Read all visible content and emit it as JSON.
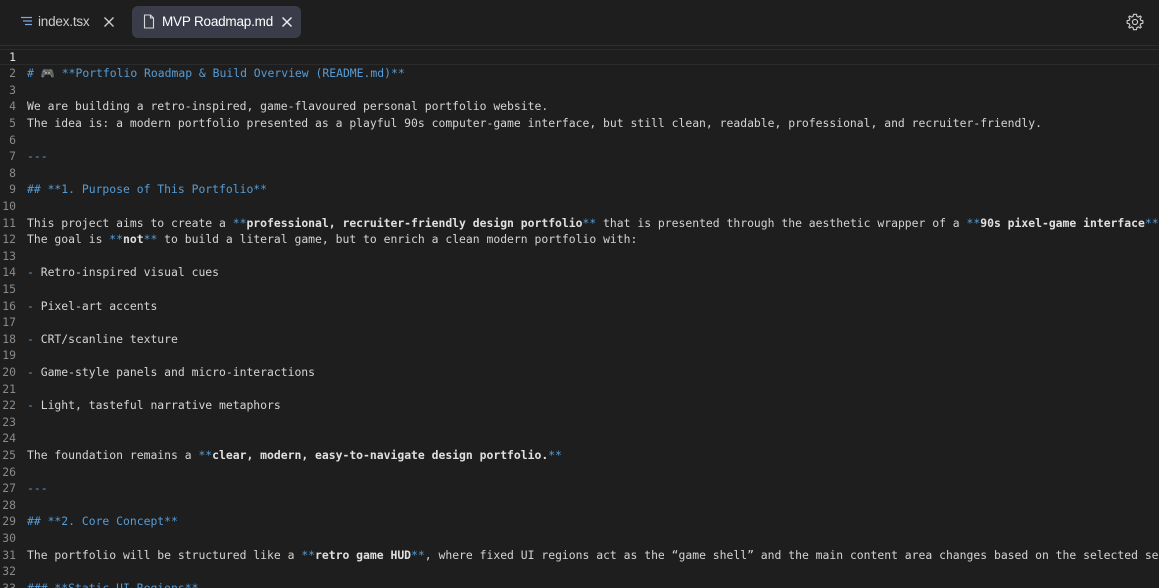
{
  "tabs": [
    {
      "label": "index.tsx",
      "icon": "list-lines-icon",
      "active": false
    },
    {
      "label": "MVP Roadmap.md",
      "icon": "file-icon",
      "active": true
    }
  ],
  "toolbar": {
    "settings_icon": "gear-icon"
  },
  "editor": {
    "current_line": 1,
    "lines": [
      {
        "n": "1",
        "segs": []
      },
      {
        "n": "2",
        "segs": [
          {
            "t": "# ",
            "c": "md-h"
          },
          {
            "t": "🎮",
            "c": "md-h"
          },
          {
            "t": " **Portfolio Roadmap & Build Overview ",
            "c": "md-h"
          },
          {
            "t": "(",
            "c": "md-mark"
          },
          {
            "t": "README.md",
            "c": "md-h"
          },
          {
            "t": ")",
            "c": "md-mark"
          },
          {
            "t": "**",
            "c": "md-h"
          }
        ]
      },
      {
        "n": "3",
        "segs": []
      },
      {
        "n": "4",
        "segs": [
          {
            "t": "We are building a retro-inspired, game-flavoured personal portfolio website."
          }
        ]
      },
      {
        "n": "5",
        "segs": [
          {
            "t": "The idea is: a modern portfolio presented as a playful 90s computer-game interface, but still clean, readable, professional, and recruiter-friendly."
          }
        ]
      },
      {
        "n": "6",
        "segs": []
      },
      {
        "n": "7",
        "segs": [
          {
            "t": "---",
            "c": "md-hr"
          }
        ]
      },
      {
        "n": "8",
        "segs": []
      },
      {
        "n": "9",
        "segs": [
          {
            "t": "## **1. Purpose of This Portfolio**",
            "c": "md-h"
          }
        ]
      },
      {
        "n": "10",
        "segs": []
      },
      {
        "n": "11",
        "segs": [
          {
            "t": "This project aims to create a "
          },
          {
            "t": "**",
            "c": "md-mark"
          },
          {
            "t": "professional, recruiter-friendly design portfolio",
            "c": "md-b"
          },
          {
            "t": "**",
            "c": "md-mark"
          },
          {
            "t": " that is presented through the aesthetic wrapper of a "
          },
          {
            "t": "**",
            "c": "md-mark"
          },
          {
            "t": "90s pixel-game interface",
            "c": "md-b"
          },
          {
            "t": "**",
            "c": "md-mark"
          },
          {
            "t": "."
          }
        ]
      },
      {
        "n": "12",
        "segs": [
          {
            "t": "The goal is "
          },
          {
            "t": "**",
            "c": "md-mark"
          },
          {
            "t": "not",
            "c": "md-b"
          },
          {
            "t": "**",
            "c": "md-mark"
          },
          {
            "t": " to build a literal game, but to enrich a clean modern portfolio with:"
          }
        ]
      },
      {
        "n": "13",
        "segs": []
      },
      {
        "n": "14",
        "segs": [
          {
            "t": "-",
            "c": "md-bullet"
          },
          {
            "t": " Retro-inspired visual cues"
          }
        ]
      },
      {
        "n": "15",
        "segs": []
      },
      {
        "n": "16",
        "segs": [
          {
            "t": "-",
            "c": "md-bullet"
          },
          {
            "t": " Pixel-art accents"
          }
        ]
      },
      {
        "n": "17",
        "segs": []
      },
      {
        "n": "18",
        "segs": [
          {
            "t": "-",
            "c": "md-bullet"
          },
          {
            "t": " CRT/scanline texture"
          }
        ]
      },
      {
        "n": "19",
        "segs": []
      },
      {
        "n": "20",
        "segs": [
          {
            "t": "-",
            "c": "md-bullet"
          },
          {
            "t": " Game-style panels and micro-interactions"
          }
        ]
      },
      {
        "n": "21",
        "segs": []
      },
      {
        "n": "22",
        "segs": [
          {
            "t": "-",
            "c": "md-bullet"
          },
          {
            "t": " Light, tasteful narrative metaphors"
          }
        ]
      },
      {
        "n": "23",
        "segs": []
      },
      {
        "n": "24",
        "segs": []
      },
      {
        "n": "25",
        "segs": [
          {
            "t": "The foundation remains a "
          },
          {
            "t": "**",
            "c": "md-mark"
          },
          {
            "t": "clear, modern, easy-to-navigate design portfolio.",
            "c": "md-b"
          },
          {
            "t": "**",
            "c": "md-mark"
          }
        ]
      },
      {
        "n": "26",
        "segs": []
      },
      {
        "n": "27",
        "segs": [
          {
            "t": "---",
            "c": "md-hr"
          }
        ]
      },
      {
        "n": "28",
        "segs": []
      },
      {
        "n": "29",
        "segs": [
          {
            "t": "## **2. Core Concept**",
            "c": "md-h"
          }
        ]
      },
      {
        "n": "30",
        "segs": []
      },
      {
        "n": "31",
        "segs": [
          {
            "t": "The portfolio will be structured like a "
          },
          {
            "t": "**",
            "c": "md-mark"
          },
          {
            "t": "retro game HUD",
            "c": "md-b"
          },
          {
            "t": "**",
            "c": "md-mark"
          },
          {
            "t": ", where fixed UI regions act as the “game shell” and the main content area changes based on the selected section."
          }
        ]
      },
      {
        "n": "32",
        "segs": []
      },
      {
        "n": "33",
        "segs": [
          {
            "t": "### **Static UI Regions**",
            "c": "md-h"
          }
        ]
      }
    ]
  }
}
